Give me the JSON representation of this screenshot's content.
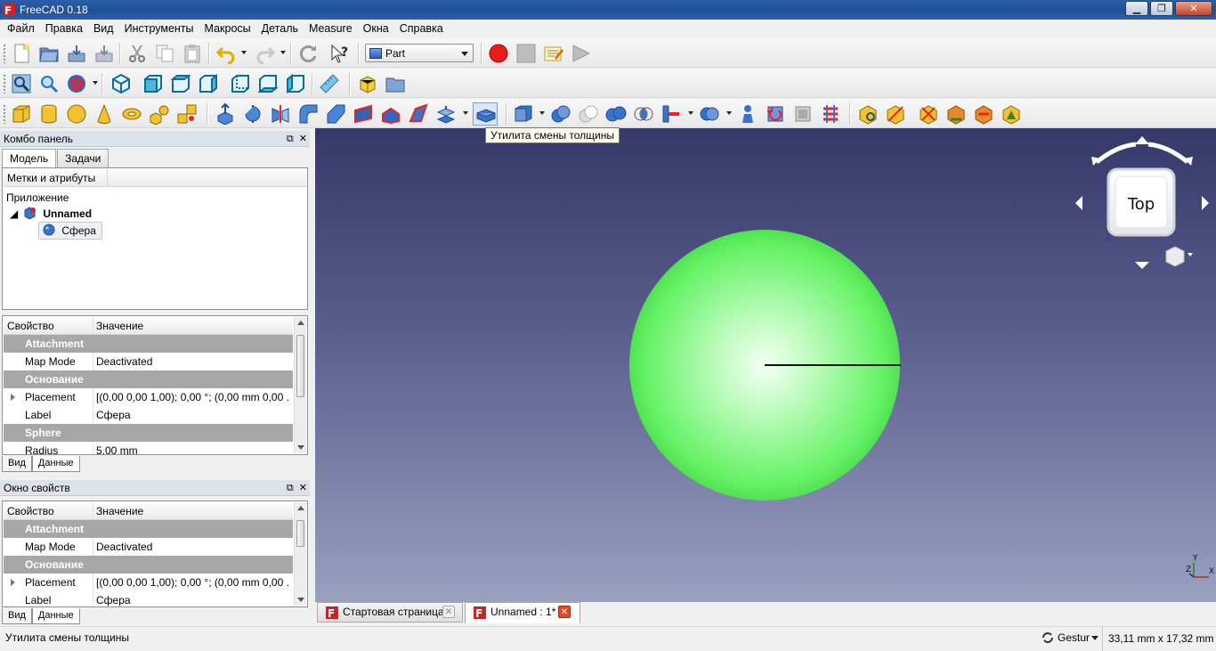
{
  "window": {
    "title": "FreeCAD 0.18",
    "minimize": "▁",
    "maximize": "❐",
    "close": "✕"
  },
  "menu": [
    "Файл",
    "Правка",
    "Вид",
    "Инструменты",
    "Макросы",
    "Деталь",
    "Measure",
    "Окна",
    "Справка"
  ],
  "workbench": {
    "selected": "Part"
  },
  "tooltip": "Утилита смены толщины",
  "combo": {
    "title": "Комбо панель",
    "tabs": [
      "Модель",
      "Задачи"
    ],
    "tree_header": "Метки и атрибуты",
    "tree_root": "Приложение",
    "document": "Unnamed",
    "object": "Сфера",
    "prop_header": {
      "key": "Свойство",
      "value": "Значение"
    },
    "props": [
      {
        "type": "group",
        "key": "Attachment"
      },
      {
        "type": "row",
        "key": "Map Mode",
        "value": "Deactivated"
      },
      {
        "type": "group",
        "key": "Основание"
      },
      {
        "type": "row",
        "key": "Placement",
        "value": "[(0,00 0,00 1,00); 0,00 °; (0,00 mm  0,00 ...",
        "expand": true
      },
      {
        "type": "row",
        "key": "Label",
        "value": "Сфера"
      },
      {
        "type": "group",
        "key": "Sphere"
      },
      {
        "type": "row",
        "key": "Radius",
        "value": "5,00 mm"
      }
    ],
    "bottom_tabs": [
      "Вид",
      "Данные"
    ]
  },
  "props_panel": {
    "title": "Окно свойств",
    "header": {
      "key": "Свойство",
      "value": "Значение"
    },
    "props": [
      {
        "type": "group",
        "key": "Attachment"
      },
      {
        "type": "row",
        "key": "Map Mode",
        "value": "Deactivated"
      },
      {
        "type": "group",
        "key": "Основание"
      },
      {
        "type": "row",
        "key": "Placement",
        "value": "[(0,00 0,00 1,00); 0,00 °; (0,00 mm  0,00 ...",
        "expand": true
      },
      {
        "type": "row",
        "key": "Label",
        "value": "Сфера"
      }
    ],
    "bottom_tabs": [
      "Вид",
      "Данные"
    ]
  },
  "navcube": {
    "face": "Top",
    "axis_z": "Z"
  },
  "axis": {
    "x": "X",
    "y": "Y",
    "z": "Z"
  },
  "doc_tabs": [
    {
      "label": "Стартовая страница",
      "active": false
    },
    {
      "label": "Unnamed : 1*",
      "active": true
    }
  ],
  "status": {
    "message": "Утилита смены толщины",
    "nav_style": "Gestur",
    "dimensions": "33,11 mm x 17,32 mm"
  },
  "colors": {
    "sphere": "#66f266",
    "view_top": "#353869",
    "view_bottom": "#9aa0bf",
    "record": "#e81e1e"
  }
}
